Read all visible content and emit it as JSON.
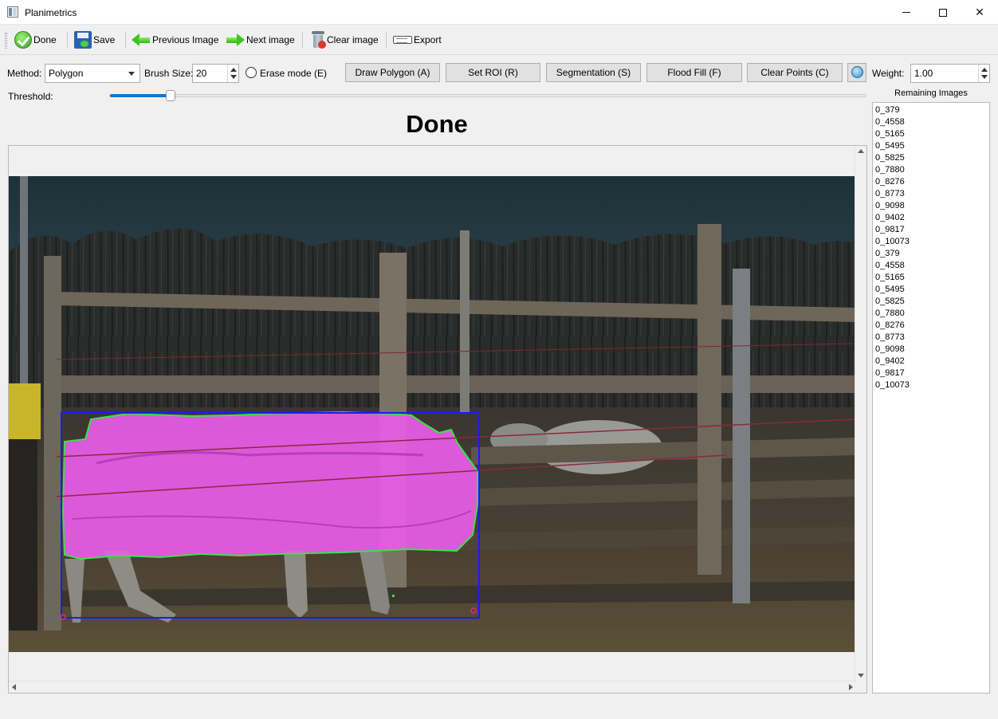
{
  "window": {
    "title": "Planimetrics"
  },
  "toolbar": {
    "done": "Done",
    "save": "Save",
    "previous": "Previous Image",
    "next": "Next image",
    "clear": "Clear image",
    "export": "Export"
  },
  "controls": {
    "method_label": "Method:",
    "method_value": "Polygon",
    "brush_label": "Brush Size:",
    "brush_value": "20",
    "erase_label": "Erase mode (E)",
    "erase_checked": false,
    "draw_polygon": "Draw Polygon (A)",
    "set_roi": "Set ROI (R)",
    "segmentation": "Segmentation (S)",
    "flood_fill": "Flood Fill (F)",
    "clear_points": "Clear Points (C)",
    "weight_label": "Weight:",
    "weight_value": "1.00",
    "threshold_label": "Threshold:",
    "threshold_fraction": 0.08
  },
  "status": "Done",
  "remaining": {
    "title": "Remaining Images",
    "items": [
      "0_379",
      "0_4558",
      "0_5165",
      "0_5495",
      "0_5825",
      "0_7880",
      "0_8276",
      "0_8773",
      "0_9098",
      "0_9402",
      "0_9817",
      "0_10073",
      "0_379",
      "0_4558",
      "0_5165",
      "0_5495",
      "0_5825",
      "0_7880",
      "0_8276",
      "0_8773",
      "0_9098",
      "0_9402",
      "0_9817",
      "0_10073"
    ]
  },
  "colors": {
    "mask": "#e85ce8",
    "contour": "#3ee04a",
    "roi": "#1a1aff",
    "accent": "#0a78d7"
  }
}
